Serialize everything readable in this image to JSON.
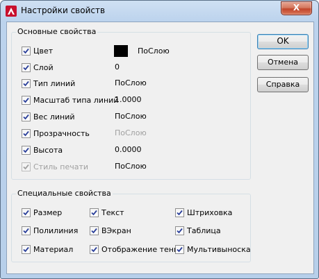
{
  "window": {
    "title": "Настройки свойств",
    "close_label": "X"
  },
  "basic": {
    "group_label": "Основные свойства",
    "rows": [
      {
        "label": "Цвет",
        "checked": true,
        "disabled": false,
        "value": "ПоСлою",
        "swatch_color": "#000000"
      },
      {
        "label": "Слой",
        "checked": true,
        "disabled": false,
        "value": "0"
      },
      {
        "label": "Тип линий",
        "checked": true,
        "disabled": false,
        "value": "ПоСлою"
      },
      {
        "label": "Масштаб типа линий",
        "checked": true,
        "disabled": false,
        "value": "1.0000"
      },
      {
        "label": "Вес линий",
        "checked": true,
        "disabled": false,
        "value": "ПоСлою"
      },
      {
        "label": "Прозрачность",
        "checked": true,
        "disabled": false,
        "value": "ПоСлою",
        "value_disabled": true
      },
      {
        "label": "Высота",
        "checked": true,
        "disabled": false,
        "value": "0.0000"
      },
      {
        "label": "Стиль печати",
        "checked": true,
        "disabled": true,
        "value": "ПоСлою"
      }
    ]
  },
  "special": {
    "group_label": "Специальные свойства",
    "items": [
      {
        "label": "Размер",
        "checked": true
      },
      {
        "label": "Текст",
        "checked": true
      },
      {
        "label": "Штриховка",
        "checked": true
      },
      {
        "label": "Полилиния",
        "checked": true
      },
      {
        "label": "ВЭкран",
        "checked": true
      },
      {
        "label": "Таблица",
        "checked": true
      },
      {
        "label": "Материал",
        "checked": true
      },
      {
        "label": "Отображение тени",
        "checked": true
      },
      {
        "label": "Мультивыноска",
        "checked": true
      }
    ]
  },
  "buttons": {
    "ok": "OK",
    "cancel": "Отмена",
    "help": "Справка"
  },
  "colors": {
    "titlebar": "#bcd3ed",
    "close": "#c2452a",
    "check": "#2a3f9a",
    "disabled_text": "#a0a0a0"
  }
}
